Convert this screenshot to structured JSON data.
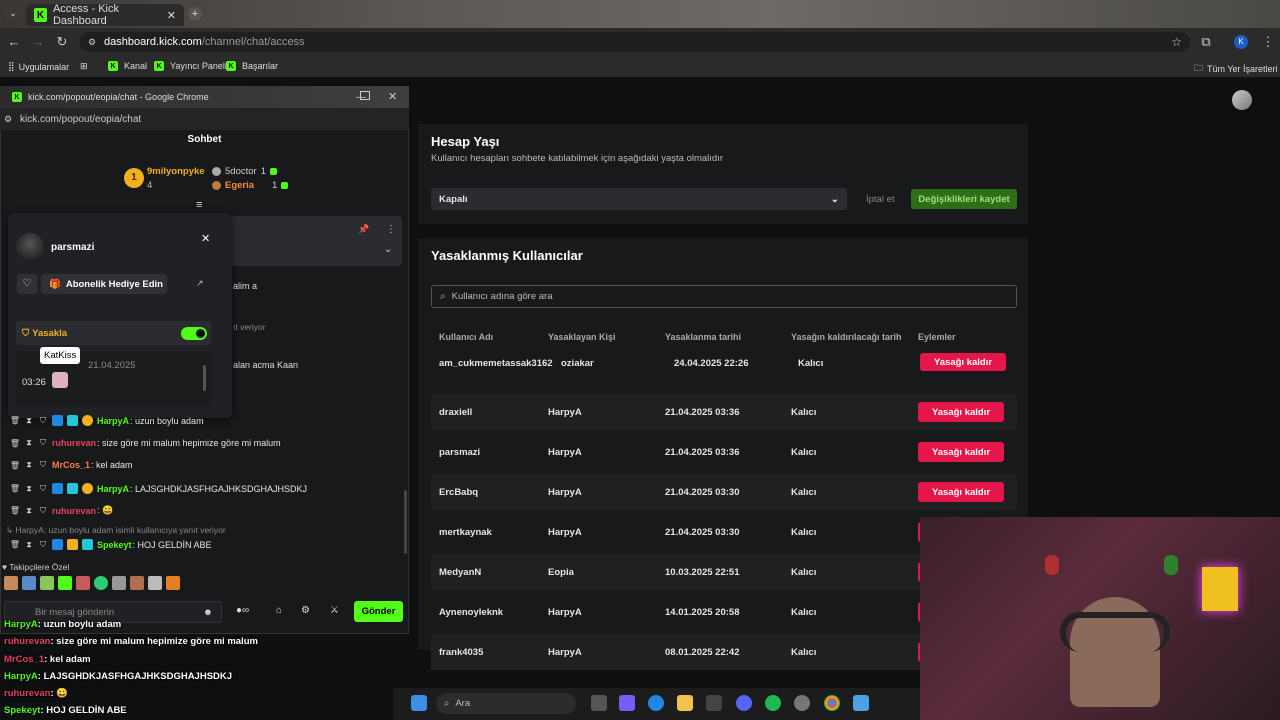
{
  "browser": {
    "tab_title": "Access - Kick Dashboard",
    "url_host": "dashboard.kick.com",
    "url_path": "/channel/chat/access",
    "bookmarks": [
      "Uygulamalar",
      "Kanal",
      "Yayıncı Paneli",
      "Başarılar"
    ],
    "other_bookmarks": "Tüm Yer İşaretleri",
    "profile_initial": "K"
  },
  "popup": {
    "title": "kick.com/popout/eopia/chat - Google Chrome",
    "url": "kick.com/popout/eopia/chat",
    "header": "Sohbet",
    "leaderboard": {
      "rank": "1",
      "first_name": "9milyonpyke",
      "first_count": "4",
      "second_name": "5doctor",
      "second_count": "1",
      "third_name": "Egeria",
      "third_count": "1"
    },
    "usercard": {
      "username": "parsmazi",
      "gift_label": "Abonelik Hediye Edin",
      "ban_label": "Yasakla",
      "tooltip": "KatKiss",
      "date": "21.04.2025",
      "time": "03:26"
    },
    "partial_lines": [
      "alim a",
      "ıt veriyor",
      "alan acma Kaan"
    ],
    "messages": [
      {
        "user": "HarpyA",
        "text": ": uzun boylu adam",
        "color": "g"
      },
      {
        "user": "ruhurevan",
        "text": ": size göre mi malum hepimize göre mi malum",
        "color": "r"
      },
      {
        "user": "MrCos_1",
        "text": ": kel adam",
        "color": "o"
      },
      {
        "user": "HarpyA",
        "text": ": LAJSGHDKJASFHGAJHKSDGHAJHSDKJ",
        "color": "g"
      },
      {
        "user": "ruhurevan",
        "text": ": 😀",
        "color": "r"
      }
    ],
    "reply_note": "HarpyA: uzun boylu adam isimli kullanıcıya yanıt veriyor",
    "last_message": {
      "user": "Spekeyt",
      "text": ": HOJ GELDİN ABE"
    },
    "followers_label": "Takipçilere Özel",
    "input_placeholder": "Bir mesaj gönderin",
    "send_label": "Gönder"
  },
  "dashboard": {
    "age": {
      "title": "Hesap Yaşı",
      "subtitle": "Kullanıcı hesapları sohbete katılabilmek için aşağıdaki yaşta olmalıdır",
      "select_value": "Kapalı",
      "cancel_label": "İptal et",
      "save_label": "Değişiklikleri kaydet"
    },
    "banned": {
      "title": "Yasaklanmış Kullanıcılar",
      "search_placeholder": "Kullanıcı adına göre ara",
      "columns": [
        "Kullanıcı Adı",
        "Yasaklayan Kişi",
        "Yasaklanma tarihi",
        "Yasağın kaldırılacağı tarih",
        "Eylemler"
      ],
      "unban_label": "Yasağı kaldır",
      "rows": [
        {
          "user": "am_cukmemetassak3162",
          "by": "oziakar",
          "date": "24.04.2025 22:26",
          "until": "Kalıcı"
        },
        {
          "user": "draxiell",
          "by": "HarpyA",
          "date": "21.04.2025 03:36",
          "until": "Kalıcı"
        },
        {
          "user": "parsmazi",
          "by": "HarpyA",
          "date": "21.04.2025 03:36",
          "until": "Kalıcı"
        },
        {
          "user": "ErcBabq",
          "by": "HarpyA",
          "date": "21.04.2025 03:30",
          "until": "Kalıcı"
        },
        {
          "user": "mertkaynak",
          "by": "HarpyA",
          "date": "21.04.2025 03:30",
          "until": "Kalıcı"
        },
        {
          "user": "MedyanN",
          "by": "Eopia",
          "date": "10.03.2025 22:51",
          "until": "Kalıcı"
        },
        {
          "user": "Aynenoyleknk",
          "by": "HarpyA",
          "date": "14.01.2025 20:58",
          "until": "Kalıcı"
        },
        {
          "user": "frank4035",
          "by": "HarpyA",
          "date": "08.01.2025 22:42",
          "until": "Kalıcı"
        }
      ]
    }
  },
  "overlay": {
    "lines": [
      {
        "user": "HarpyA",
        "text": ": uzun boylu adam",
        "color": "#53fc18"
      },
      {
        "user": "ruhurevan",
        "text": ": size göre mi malum hepimize göre mi malum",
        "color": "#e8415f"
      },
      {
        "user": "MrCos_1",
        "text": ": kel adam",
        "color": "#e8415f"
      },
      {
        "user": "HarpyA",
        "text": ": LAJSGHDKJASFHGAJHKSDGHAJHSDKJ",
        "color": "#53fc18"
      },
      {
        "user": "ruhurevan",
        "text": ": 😀",
        "color": "#e8415f"
      },
      {
        "user": "Spekeyt",
        "text": ": HOJ GELDİN ABE",
        "color": "#53fc18"
      }
    ]
  },
  "taskbar": {
    "search_placeholder": "Ara"
  },
  "colors": {
    "kick_green": "#53fc18",
    "unban_red": "#e5164a",
    "panel": "#18191b"
  }
}
